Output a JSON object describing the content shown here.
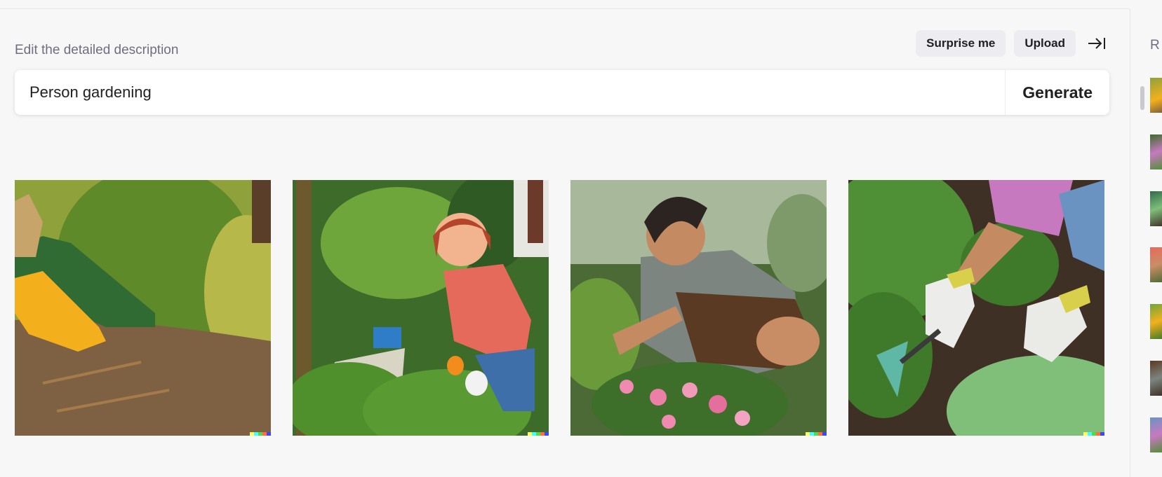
{
  "header": {
    "heading": "Edit the detailed description",
    "surprise_label": "Surprise me",
    "upload_label": "Upload"
  },
  "prompt": {
    "value": "Person gardening",
    "generate_label": "Generate"
  },
  "results": [
    {
      "subject": "gloved hand planting near boot"
    },
    {
      "subject": "smiling woman with trowel"
    },
    {
      "subject": "man kneeling in flower bed"
    },
    {
      "subject": "gloved hands with hand rake"
    }
  ],
  "sidebar": {
    "letter": "R"
  },
  "colors": {
    "background": "#f7f7f8",
    "chip": "#ececf1",
    "text": "#202123",
    "muted": "#6e6e80",
    "signature": [
      "#ffff66",
      "#42ffff",
      "#51da4c",
      "#ff6e3c",
      "#3c46ff"
    ]
  }
}
